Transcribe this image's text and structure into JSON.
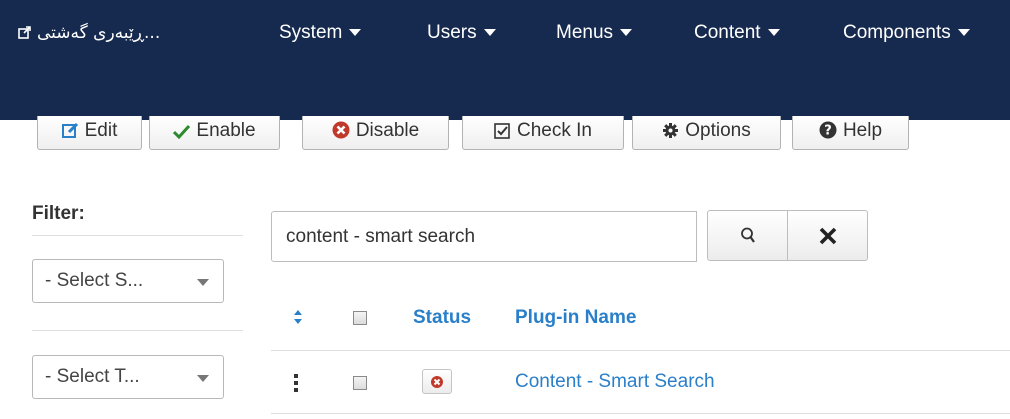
{
  "navbar": {
    "site_link": "...ڕێبەری گەشتی",
    "menus": [
      {
        "label": "System"
      },
      {
        "label": "Users"
      },
      {
        "label": "Menus"
      },
      {
        "label": "Content"
      },
      {
        "label": "Components"
      }
    ]
  },
  "toolbar": {
    "edit": "Edit",
    "enable": "Enable",
    "disable": "Disable",
    "checkin": "Check In",
    "options": "Options",
    "help": "Help"
  },
  "sidebar": {
    "filter_title": "Filter:",
    "select_status": "- Select S...",
    "select_type": "- Select T..."
  },
  "search": {
    "value": "content - smart search"
  },
  "table": {
    "headers": {
      "status": "Status",
      "name": "Plug-in Name"
    },
    "rows": [
      {
        "name": "Content - Smart Search",
        "status": "disabled"
      }
    ]
  },
  "colors": {
    "navbar_bg": "#16294e",
    "link": "#2a7fc9",
    "enable_green": "#2e8a2e",
    "disable_red": "#c0392b"
  }
}
